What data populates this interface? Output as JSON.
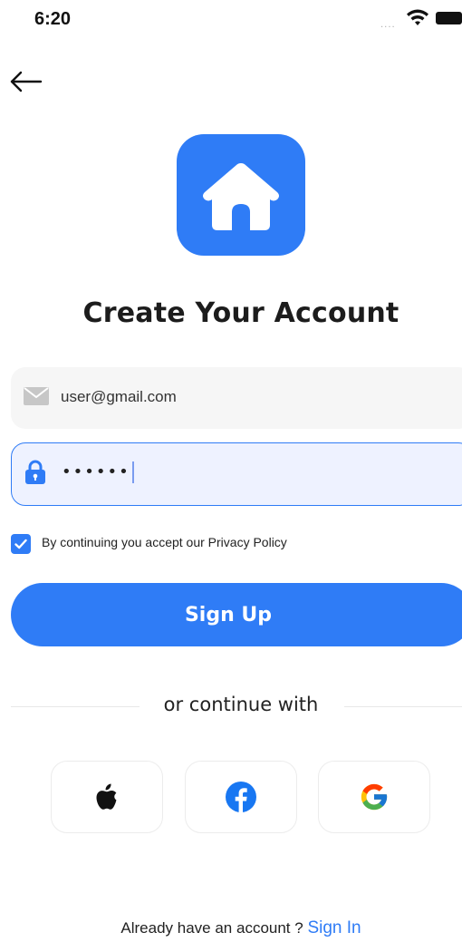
{
  "status_bar": {
    "time": "6:20"
  },
  "title": "Create Your Account",
  "email": {
    "value": "user@gmail.com"
  },
  "password": {
    "value": "••••••"
  },
  "policy": {
    "text": "By continuing you accept our Privacy Policy",
    "checked": true
  },
  "signup_label": "Sign Up",
  "divider_text": "or continue with",
  "social": [
    "apple-icon",
    "facebook-icon",
    "google-icon"
  ],
  "footer": {
    "prompt": "Already have an account ? ",
    "link": "Sign In"
  },
  "colors": {
    "accent": "#2f7cf6",
    "field_bg": "#f6f6f6",
    "active_field_bg": "#eef2ff"
  }
}
